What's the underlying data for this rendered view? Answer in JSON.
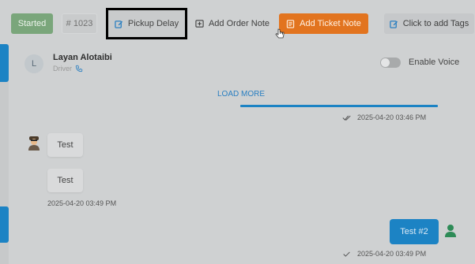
{
  "toolbar": {
    "status_label": "Started",
    "order_number": "# 1023",
    "pickup_delay_label": "Pickup Delay",
    "add_order_note_label": "Add Order Note",
    "add_ticket_note_label": "Add Ticket Note",
    "add_tags_label": "Click to add Tags"
  },
  "contact": {
    "initial": "L",
    "name": "Layan Alotaibi",
    "role": "Driver",
    "enable_voice_label": "Enable Voice",
    "enable_voice_on": false
  },
  "chat": {
    "load_more_label": "LOAD MORE",
    "messages": [
      {
        "timestamp": "2025-04-20 03:46 PM"
      },
      {
        "text": "Test"
      },
      {
        "text": "Test"
      },
      {
        "timestamp": "2025-04-20 03:49 PM"
      },
      {
        "text": "Test #2"
      },
      {
        "timestamp": "2025-04-20 03:49 PM"
      }
    ]
  },
  "colors": {
    "status_green": "#7aa67b",
    "accent_blue": "#1c83c4",
    "ticket_orange": "#e2741f"
  },
  "icons": [
    "edit-icon",
    "note-plus-icon",
    "ticket-note-icon",
    "tag-edit-icon",
    "phone-icon",
    "check-icon",
    "agent-avatar-icon",
    "user-avatar-icon"
  ]
}
